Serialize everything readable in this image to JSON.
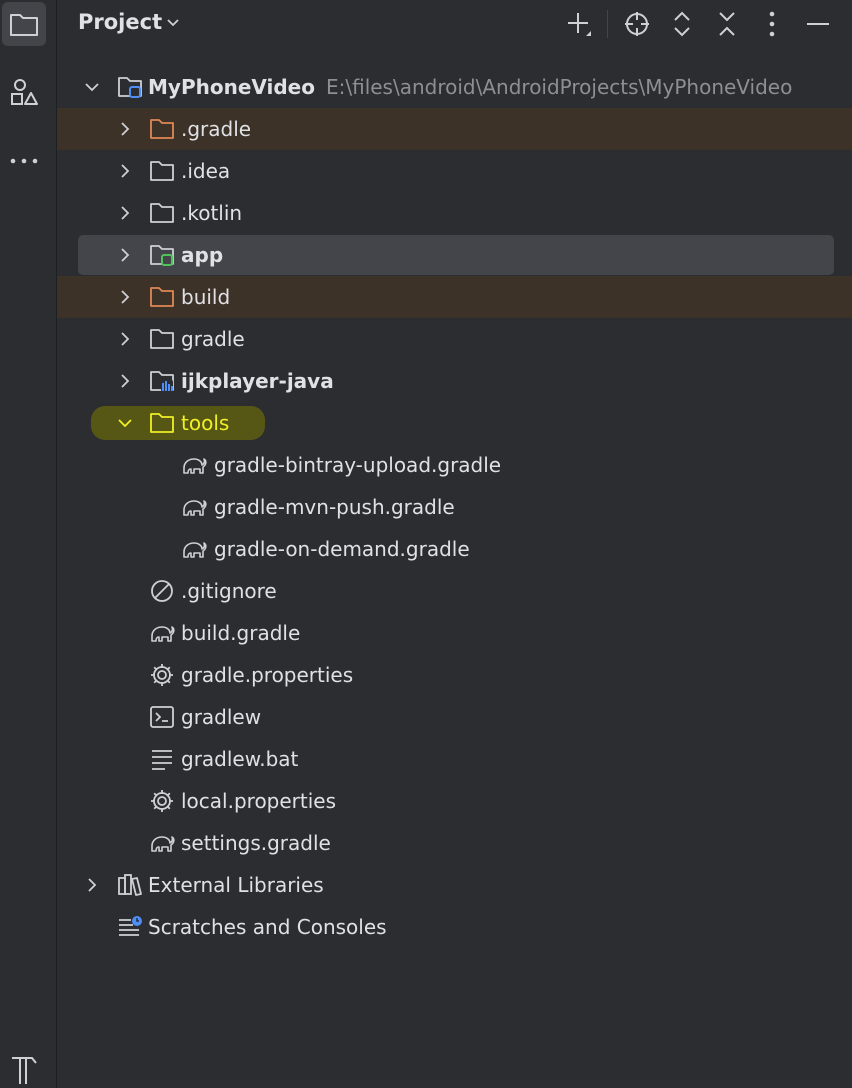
{
  "panel": {
    "title": "Project"
  },
  "toolbar": {
    "icons": [
      "add-icon",
      "locate-icon",
      "expand-all-icon",
      "collapse-all-icon",
      "more-icon",
      "hide-icon"
    ]
  },
  "tree": {
    "root": {
      "name": "MyPhoneVideo",
      "path": "E:\\files\\android\\AndroidProjects\\MyPhoneVideo"
    },
    "items": [
      {
        "label": ".gradle"
      },
      {
        "label": ".idea"
      },
      {
        "label": ".kotlin"
      },
      {
        "label": "app"
      },
      {
        "label": "build"
      },
      {
        "label": "gradle"
      },
      {
        "label": "ijkplayer-java"
      },
      {
        "label": "tools"
      },
      {
        "label": "gradle-bintray-upload.gradle"
      },
      {
        "label": "gradle-mvn-push.gradle"
      },
      {
        "label": "gradle-on-demand.gradle"
      },
      {
        "label": ".gitignore"
      },
      {
        "label": "build.gradle"
      },
      {
        "label": "gradle.properties"
      },
      {
        "label": "gradlew"
      },
      {
        "label": "gradlew.bat"
      },
      {
        "label": "local.properties"
      },
      {
        "label": "settings.gradle"
      }
    ],
    "external_libraries": "External Libraries",
    "scratches": "Scratches and Consoles"
  },
  "colors": {
    "background": "#2b2d30",
    "excluded_row": "#3d3228",
    "selected_row": "#43454a",
    "highlight_marker": "#5a5a14",
    "highlight_text": "#f0f024",
    "module_badge": "#4fc35a",
    "path_text": "#8c8f94"
  }
}
